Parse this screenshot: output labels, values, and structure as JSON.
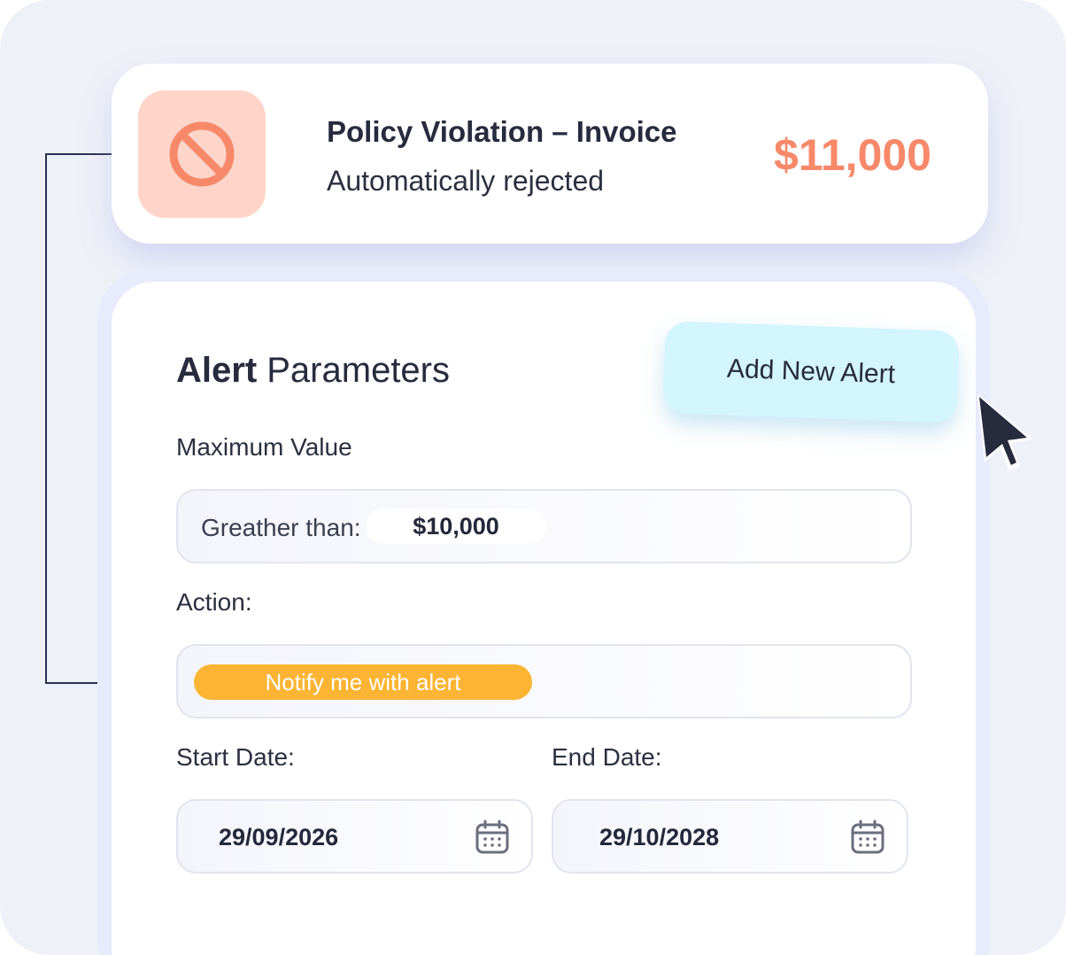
{
  "violation": {
    "title": "Policy Violation – Invoice",
    "subtitle": "Automatically rejected",
    "amount": "$11,000",
    "icon": "prohibited-icon",
    "accent_color": "#f7896a"
  },
  "alert_panel": {
    "title_bold": "Alert",
    "title_rest": " Parameters",
    "add_button_label": "Add New Alert",
    "max_value": {
      "label": "Maximum Value",
      "prefix": "Greather than:",
      "value": "$10,000"
    },
    "action": {
      "label": "Action:",
      "selected": "Notify me with alert",
      "chip_color": "#fbb433"
    },
    "start_date": {
      "label": "Start Date:",
      "value": "29/09/2026",
      "icon": "calendar-icon"
    },
    "end_date": {
      "label": "End Date:",
      "value": "29/10/2028",
      "icon": "calendar-icon"
    }
  },
  "cursor": {
    "icon": "pointer-cursor-icon"
  }
}
